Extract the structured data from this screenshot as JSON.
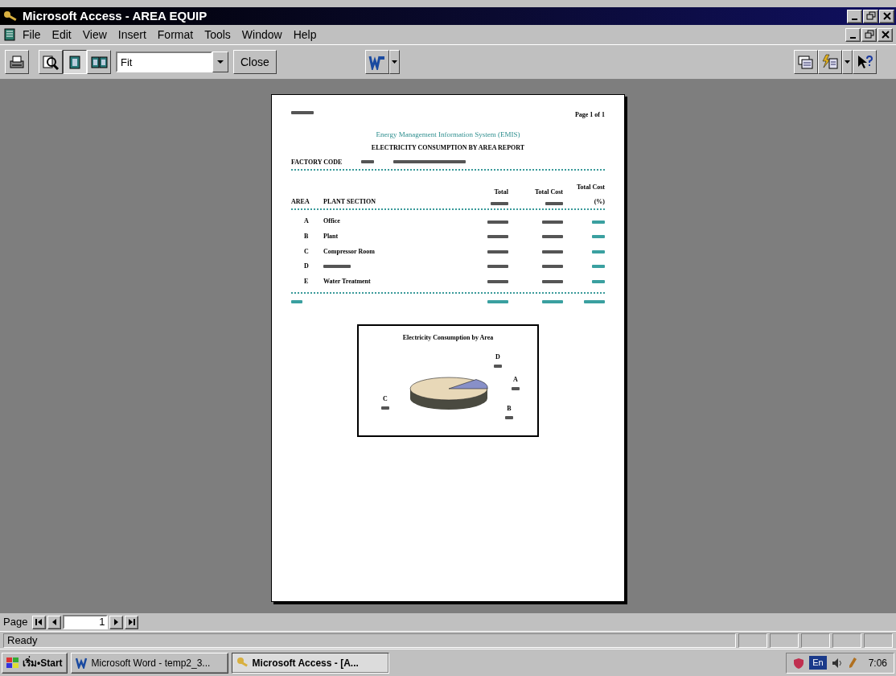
{
  "window": {
    "title": "Microsoft Access - AREA EQUIP"
  },
  "menu": [
    {
      "label": "File"
    },
    {
      "label": "Edit"
    },
    {
      "label": "View"
    },
    {
      "label": "Insert"
    },
    {
      "label": "Format"
    },
    {
      "label": "Tools"
    },
    {
      "label": "Window"
    },
    {
      "label": "Help"
    }
  ],
  "toolbar": [
    {
      "kind": "print",
      "pressed": false
    },
    {
      "kind": "zoom",
      "pressed": false
    },
    {
      "kind": "one-page",
      "pressed": true
    },
    {
      "kind": "two-pages",
      "pressed": false
    },
    {
      "kind": "zoom-box",
      "value": "Fit"
    },
    {
      "kind": "text",
      "label": "Close"
    },
    {
      "kind": "office-links",
      "pressed": false
    },
    {
      "kind": "database-window",
      "pressed": false
    },
    {
      "kind": "new-object",
      "pressed": false
    },
    {
      "kind": "help",
      "pressed": false
    }
  ],
  "report": {
    "page_number": "Page 1 of 1",
    "title": "Energy Management Information System (EMIS)",
    "subtitle": "ELECTRICITY CONSUMPTION BY AREA REPORT",
    "factory_label": "FACTORY CODE",
    "columns": [
      {
        "line2": "AREA"
      },
      {
        "line2": "PLANT SECTION"
      },
      {
        "line1": "Total"
      },
      {
        "line1": "Total Cost"
      },
      {
        "line1": "Total Cost",
        "line2": "(%)"
      }
    ],
    "rows": [
      {
        "area": "A",
        "section": "Office"
      },
      {
        "area": "B",
        "section": "Plant"
      },
      {
        "area": "C",
        "section": "Compressor Room"
      },
      {
        "area": "D"
      },
      {
        "area": "E",
        "section": "Water Treatment"
      }
    ],
    "chart_title": "Electricity Consumption by Area",
    "slice_labels": [
      {
        "label": "D"
      },
      {
        "label": "A"
      },
      {
        "label": "B"
      },
      {
        "label": "C"
      }
    ]
  },
  "page_nav": {
    "label": "Page",
    "value": "1"
  },
  "status_bar": "Ready",
  "taskbar": {
    "start": "เริ่ม•Start",
    "tasks": [
      {
        "label": "Microsoft Word - temp2_3...",
        "kind": "word",
        "selected": false
      },
      {
        "label": "Microsoft Access - [A...",
        "kind": "access",
        "selected": true
      }
    ],
    "tray_lang": "En",
    "clock": "7:06"
  }
}
